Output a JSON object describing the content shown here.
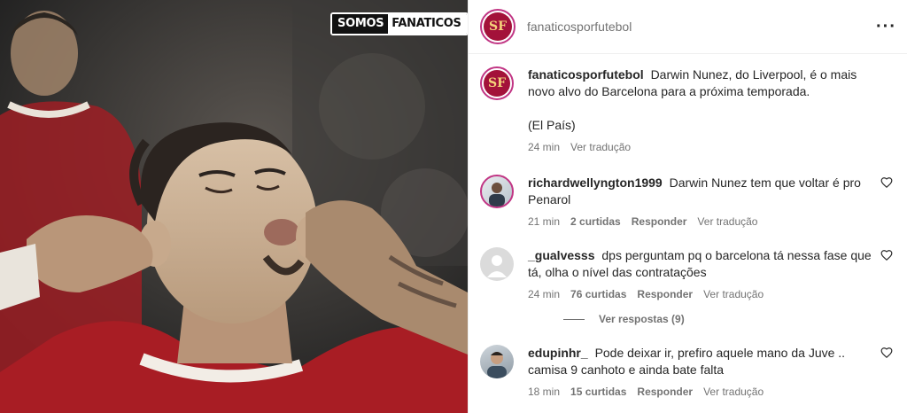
{
  "brand": {
    "part1": "SOMOS",
    "part2": "FANATICOS"
  },
  "post": {
    "username": "fanaticosporfutebol",
    "avatar_text": "SF",
    "menu_icon": "more-horizontal-icon",
    "caption_user": "fanaticosporfutebol",
    "caption_text": "Darwin Nunez, do Liverpool, é o mais novo alvo do Barcelona para a próxima temporada.",
    "caption_source": "(El País)",
    "caption_time": "24 min",
    "caption_translate": "Ver tradução"
  },
  "comments": [
    {
      "user": "richardwellyngton1999",
      "text": "Darwin Nunez tem que voltar é pro Penarol",
      "time": "21 min",
      "likes": "2 curtidas",
      "reply": "Responder",
      "translate": "Ver tradução"
    },
    {
      "user": "_gualvesss",
      "text": "dps perguntam pq o barcelona tá nessa fase que tá, olha o nível das contratações",
      "time": "24 min",
      "likes": "76 curtidas",
      "reply": "Responder",
      "translate": "Ver tradução",
      "view_replies": "Ver respostas (9)"
    },
    {
      "user": "edupinhr_",
      "text": "Pode deixar ir, prefiro aquele mano da Juve .. camisa 9 canhoto e ainda bate falta",
      "time": "18 min",
      "likes": "15 curtidas",
      "reply": "Responder",
      "translate": "Ver tradução"
    }
  ],
  "colors": {
    "accent_ring": "#c13584",
    "club_red": "#a3123a",
    "muted": "#737373"
  }
}
